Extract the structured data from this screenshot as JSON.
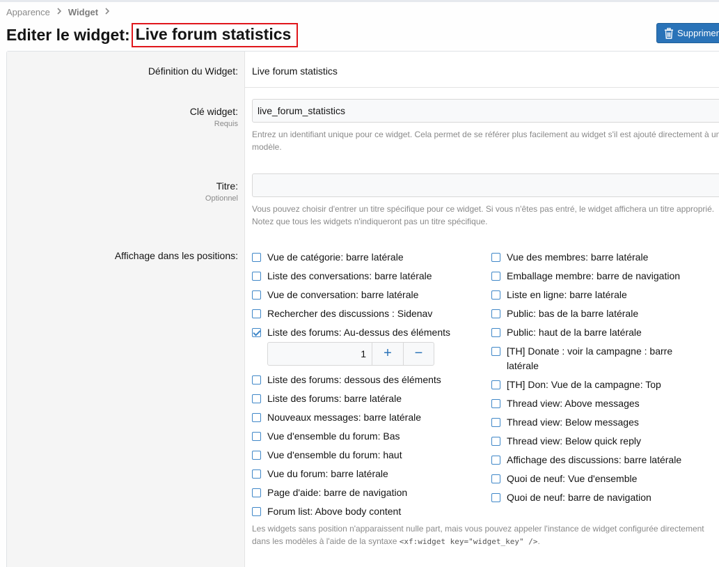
{
  "breadcrumb": {
    "items": [
      "Apparence",
      "Widget"
    ]
  },
  "header": {
    "title_prefix": "Editer le widget:",
    "title_name": "Live forum statistics",
    "delete_label": "Supprimer"
  },
  "form": {
    "definition": {
      "label": "Définition du Widget:",
      "value": "Live forum statistics"
    },
    "key": {
      "label": "Clé widget:",
      "sub": "Requis",
      "value": "live_forum_statistics",
      "hint": "Entrez un identifiant unique pour ce widget. Cela permet de se référer plus facilement au widget s'il est ajouté directement à un modèle."
    },
    "title": {
      "label": "Titre:",
      "sub": "Optionnel",
      "value": "",
      "hint": "Vous pouvez choisir d'entrer un titre spécifique pour ce widget. Si vous n'êtes pas entré, le widget affichera un titre approprié. Notez que tous les widgets n'indiqueront pas un titre spécifique."
    },
    "positions": {
      "label": "Affichage dans les positions:",
      "left": [
        {
          "label": "Vue de catégorie: barre latérale",
          "checked": false
        },
        {
          "label": "Liste des conversations: barre latérale",
          "checked": false
        },
        {
          "label": "Vue de conversation: barre latérale",
          "checked": false
        },
        {
          "label": "Rechercher des discussions : Sidenav",
          "checked": false
        },
        {
          "label": "Liste des forums: Au-dessus des éléments",
          "checked": true
        },
        {
          "label": "Liste des forums: dessous des éléments",
          "checked": false
        },
        {
          "label": "Liste des forums: barre latérale",
          "checked": false
        },
        {
          "label": "Nouveaux messages: barre latérale",
          "checked": false
        },
        {
          "label": "Vue d'ensemble du forum: Bas",
          "checked": false
        },
        {
          "label": "Vue d'ensemble du forum: haut",
          "checked": false
        },
        {
          "label": "Vue du forum: barre latérale",
          "checked": false
        },
        {
          "label": "Page d'aide: barre de navigation",
          "checked": false
        },
        {
          "label": "Forum list: Above body content",
          "checked": false
        }
      ],
      "right": [
        {
          "label": "Vue des membres: barre latérale",
          "checked": false
        },
        {
          "label": "Emballage membre: barre de navigation",
          "checked": false
        },
        {
          "label": "Liste en ligne: barre latérale",
          "checked": false
        },
        {
          "label": "Public: bas de la barre latérale",
          "checked": false
        },
        {
          "label": "Public: haut de la barre latérale",
          "checked": false
        },
        {
          "label": "[TH] Donate : voir la campagne : barre latérale",
          "checked": false
        },
        {
          "label": "[TH] Don: Vue de la campagne: Top",
          "checked": false
        },
        {
          "label": "Thread view: Above messages",
          "checked": false
        },
        {
          "label": "Thread view: Below messages",
          "checked": false
        },
        {
          "label": "Thread view: Below quick reply",
          "checked": false
        },
        {
          "label": "Affichage des discussions: barre latérale",
          "checked": false
        },
        {
          "label": "Quoi de neuf: Vue d'ensemble",
          "checked": false
        },
        {
          "label": "Quoi de neuf: barre de navigation",
          "checked": false
        }
      ],
      "order_value": "1",
      "stepper_plus": "+",
      "stepper_minus": "−",
      "hint_prefix": "Les widgets sans position n'apparaissent nulle part, mais vous pouvez appeler l'instance de widget configurée directement dans les modèles à l'aide de la syntaxe ",
      "hint_code": "<xf:widget key=\"widget_key\" />",
      "hint_suffix": "."
    }
  },
  "colors": {
    "accent": "#2a73b8",
    "highlight_border": "#e0161b",
    "label_bg": "#f5f5f5"
  },
  "icons": {
    "delete": "trash-icon",
    "breadcrumb_separator": "chevron-right-icon"
  }
}
